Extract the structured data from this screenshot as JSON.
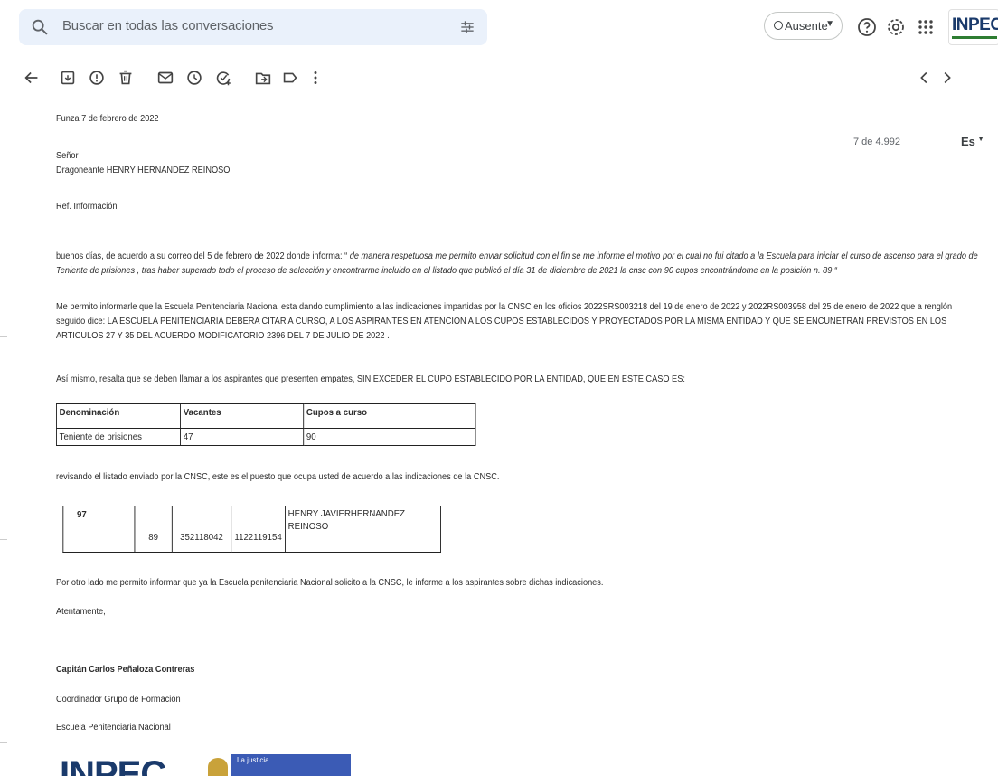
{
  "search": {
    "placeholder": "Buscar en todas las conversaciones"
  },
  "status": {
    "label": "Ausente"
  },
  "brand": {
    "top_logo_text": "INPEC"
  },
  "pager": {
    "text": "7 de 4.992"
  },
  "language": {
    "label": "Es"
  },
  "letter": {
    "place_date": "Funza 7 de febrero de 2022",
    "salutation": "Señor",
    "recipient": "Dragoneante HENRY HERNANDEZ REINOSO",
    "ref": "Ref. Información",
    "p1_intro": "buenos días, de acuerdo a su correo  del 5 de febrero de 2022 donde informa: “",
    "p1_quote": " de manera respetuosa me permito enviar solicitud con el fin se me informe el motivo por el cual no fui citado a la Escuela para iniciar el curso de ascenso para el grado de Teniente de prisiones , tras haber superado todo el proceso de selección y encontrarme incluido en el listado que publicó el día 31 de diciembre de 2021 la cnsc  con 90 cupos encontrándome en la posición n. 89 “",
    "p2": "Me permito informarle que la Escuela Penitenciaria Nacional esta dando cumplimiento a las indicaciones impartidas por la CNSC  en los oficios 2022SRS003218 del 19 de enero de 2022 y 2022RS003958 del 25 de enero de 2022 que a renglón seguido dice: LA ESCUELA PENITENCIARIA DEBERA CITAR A CURSO, A LOS ASPIRANTES  EN ATENCION A LOS CUPOS ESTABLECIDOS  Y PROYECTADOS POR LA MISMA ENTIDAD  Y QUE SE ENCUNETRAN PREVISTOS  EN LOS ARTICULOS 27 Y 35  DEL ACUERDO MODIFICATORIO 2396 DEL 7 DE JULIO DE 2022 .",
    "p3": "Así mismo, resalta  que se deben llamar a los aspirantes   que  presenten empates, SIN EXCEDER  EL CUPO ESTABLECIDO POR LA ENTIDAD, QUE EN ESTE CASO ES:",
    "table1": {
      "headers": [
        "Denominación",
        "Vacantes",
        "Cupos a curso"
      ],
      "row": [
        "Teniente de prisiones",
        "47",
        "90"
      ]
    },
    "p4": "revisando el listado enviado por la CNSC, este es  el puesto que ocupa usted de acuerdo a las indicaciones de la CNSC.",
    "table2": {
      "c1": "97",
      "c2": "89",
      "c3": "352118042",
      "c4": "1122119154",
      "c5_line1": "HENRY JAVIERHERNANDEZ",
      "c5_line2": "REINOSO"
    },
    "p5": "Por otro lado me permito informar que ya la Escuela penitenciaria Nacional solicito a la CNSC, le informe a los aspirantes sobre dichas indicaciones.",
    "closing": "Atentamente,",
    "signer": "Capitán Carlos Peñaloza Contreras",
    "role": "Coordinador Grupo de Formación",
    "org": "Escuela Penitenciaria Nacional"
  },
  "footer_logo": {
    "text": "INPEC",
    "badge": "La justicia"
  },
  "colors": {
    "search_bg": "#eaf1fb",
    "brand_blue": "#1a3a6b",
    "icon_gray": "#5f6368"
  }
}
